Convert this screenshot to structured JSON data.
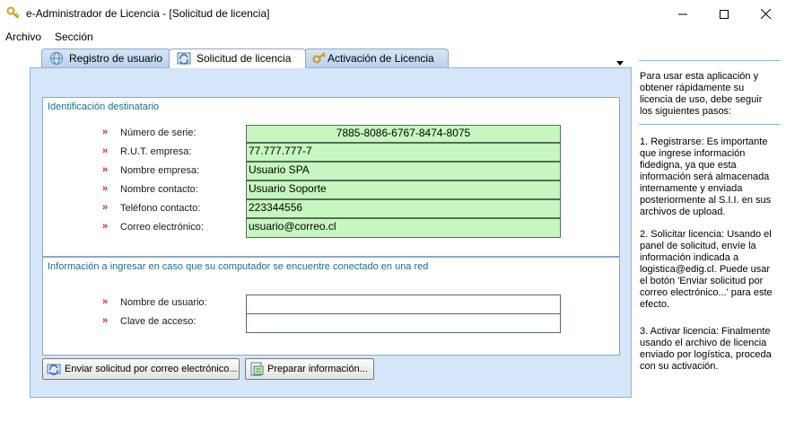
{
  "window": {
    "title": "e-Administrador de Licencia - [Solicitud de licencia]",
    "minimize_icon": "minimize-icon",
    "maximize_icon": "maximize-icon",
    "close_icon": "close-icon"
  },
  "menu": {
    "items": [
      "Archivo",
      "Sección"
    ]
  },
  "tabs": [
    {
      "label": "Registro de usuario",
      "icon": "globe-icon",
      "active": false
    },
    {
      "label": "Solicitud de licencia",
      "icon": "refresh-icon",
      "active": true
    },
    {
      "label": "Activación de Licencia",
      "icon": "key-icon",
      "active": false
    }
  ],
  "identificacion": {
    "title": "Identificación destinatario",
    "marker": "»",
    "fields": [
      {
        "label": "Número de serie:",
        "value": "7885-8086-6767-8474-8075"
      },
      {
        "label": "R.U.T. empresa:",
        "value": "77.777.777-7"
      },
      {
        "label": "Nombre empresa:",
        "value": "Usuario SPA"
      },
      {
        "label": "Nombre contacto:",
        "value": "Usuario Soporte"
      },
      {
        "label": "Teléfono contacto:",
        "value": "223344556"
      },
      {
        "label": "Correo electrónico:",
        "value": "usuario@correo.cl"
      }
    ]
  },
  "red": {
    "title": "Información a ingresar en caso que su computador se encuentre conectado en una red",
    "fields": [
      {
        "label": "Nombre de usuario:",
        "value": ""
      },
      {
        "label": "Clave de acceso:",
        "value": ""
      }
    ]
  },
  "buttons": {
    "send_email": "Enviar solicitud por correo electrónico...",
    "prepare": "Preparar información..."
  },
  "help": {
    "intro": "Para usar esta aplicación y obtener rápidamente su licencia de uso, debe seguir los siguientes pasos:",
    "step1": "1. Registrarse: Es importante que ingrese información fidedigna, ya que esta información será almacenada internamente y enviada posteriormente al S.I.I. en sus archivos de upload.",
    "step2": "2. Solicitar licencia: Usando el panel de solicitud, envíe la información indicada a logistica@edig.cl. Puede usar el botón 'Enviar solicitud por correo electrónico...' para este efecto.",
    "step3": "3. Activar licencia: Finalmente usando el archivo de licencia enviado por logística, proceda con su activación."
  },
  "colors": {
    "field_green": "#c6f7c0",
    "panel_blue": "#d4e6f7",
    "group_title": "#1a6f8f",
    "marker_red": "#c0302b"
  }
}
